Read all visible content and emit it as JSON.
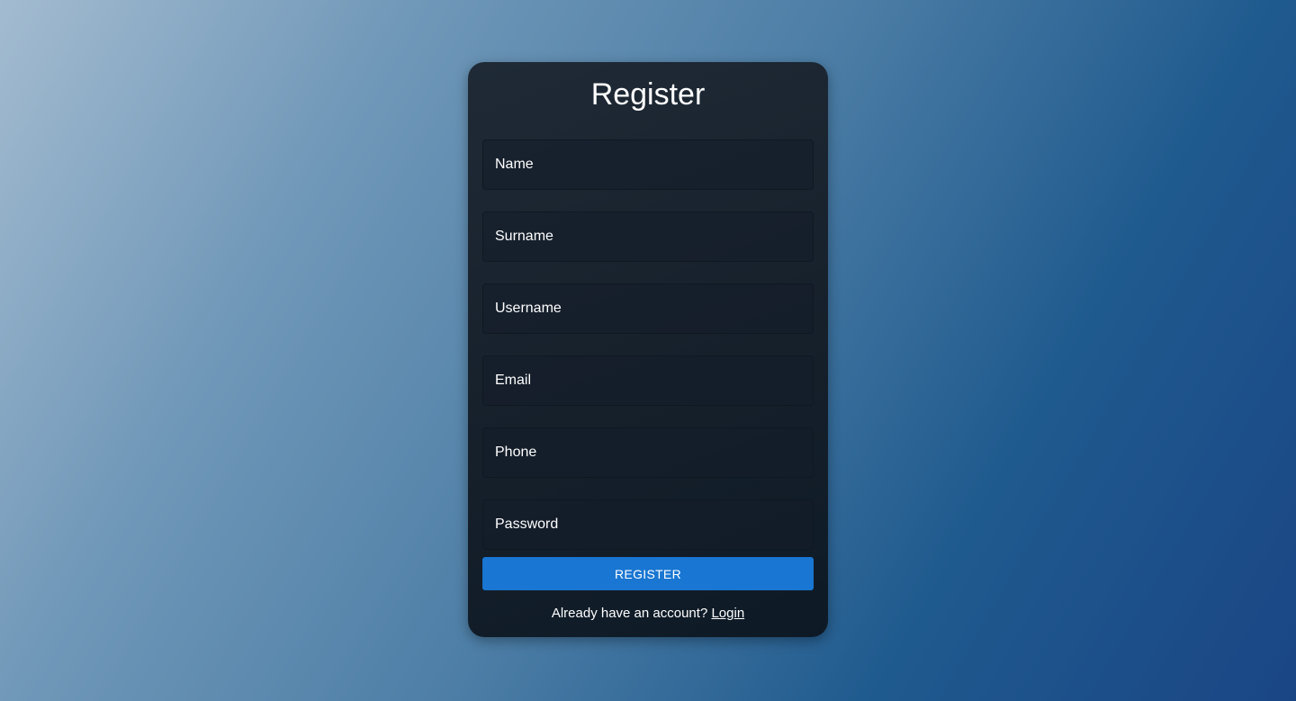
{
  "form": {
    "title": "Register",
    "fields": [
      {
        "placeholder": "Name",
        "value": ""
      },
      {
        "placeholder": "Surname",
        "value": ""
      },
      {
        "placeholder": "Username",
        "value": ""
      },
      {
        "placeholder": "Email",
        "value": ""
      },
      {
        "placeholder": "Phone",
        "value": ""
      },
      {
        "placeholder": "Password",
        "value": ""
      }
    ],
    "submit_label": "REGISTER",
    "footer_text": "Already have an account?",
    "login_link": "Login"
  },
  "colors": {
    "button": "#1976d2",
    "card": "#16202b",
    "text": "#ffffff"
  }
}
